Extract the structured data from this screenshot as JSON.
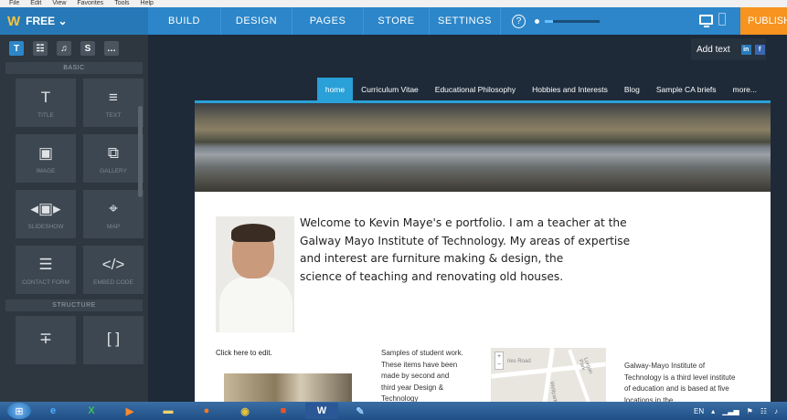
{
  "menubar": {
    "items": [
      "File",
      "Edit",
      "View",
      "Favorites",
      "Tools",
      "Help"
    ]
  },
  "header": {
    "plan": "FREE ⌄",
    "tabs": [
      "BUILD",
      "DESIGN",
      "PAGES",
      "STORE",
      "SETTINGS"
    ],
    "help_label": "?",
    "zoom_fraction": 0.15,
    "publish": "PUBLISH"
  },
  "sidebar": {
    "tools": [
      "T",
      "☷",
      "♫",
      "S",
      "…"
    ],
    "basic_label": "BASIC",
    "basic_items": [
      {
        "label": "TITLE",
        "icon": "title-icon",
        "glyph": "T"
      },
      {
        "label": "TEXT",
        "icon": "text-icon",
        "glyph": "≡"
      },
      {
        "label": "IMAGE",
        "icon": "image-icon",
        "glyph": "▣"
      },
      {
        "label": "GALLERY",
        "icon": "gallery-icon",
        "glyph": "⧉"
      },
      {
        "label": "SLIDESHOW",
        "icon": "slideshow-icon",
        "glyph": "◂▣▸"
      },
      {
        "label": "MAP",
        "icon": "map-pin-icon",
        "glyph": "⌖"
      },
      {
        "label": "CONTACT FORM",
        "icon": "contact-form-icon",
        "glyph": "☰"
      },
      {
        "label": "EMBED CODE",
        "icon": "embed-code-icon",
        "glyph": "</>"
      }
    ],
    "structure_label": "STRUCTURE",
    "structure_items": [
      {
        "label": "",
        "icon": "divider-icon",
        "glyph": "∓"
      },
      {
        "label": "",
        "icon": "spacer-icon",
        "glyph": "[ ]"
      }
    ]
  },
  "editor": {
    "add_text": "Add text",
    "share_in": "in",
    "share_f": "f"
  },
  "site": {
    "nav": [
      "home",
      "Curriculum Vitae",
      "Educational Philosophy",
      "Hobbies and Interests",
      "Blog",
      "Sample CA briefs",
      "more..."
    ],
    "welcome_lines": [
      "Welcome to Kevin Maye's e portfolio. I am a teacher at the",
      "Galway Mayo Institute of Technology. My areas of expertise",
      "and interest are furniture making & design, the",
      "science of teaching and renovating old houses."
    ],
    "click_edit": "Click here to edit.",
    "samples": "Samples of student work. These items have been made by second and third year Design & Technology",
    "map_labels": [
      "ries Road",
      "Wellpark Road",
      "Lurgan Park"
    ],
    "gmit": "Galway-Mayo Institute of Technology is a third level institute of education and is based at five locations in the"
  },
  "taskbar": {
    "apps": [
      "ie",
      "excel",
      "media",
      "explorer",
      "firefox",
      "chrome",
      "office",
      "word",
      "paint"
    ],
    "lang": "EN"
  }
}
